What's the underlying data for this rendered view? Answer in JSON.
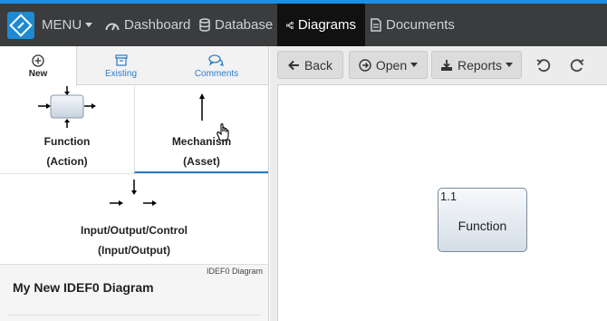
{
  "navbar": {
    "menu_label": "MENU",
    "items": [
      {
        "label": "Dashboard",
        "icon": "dashboard-icon"
      },
      {
        "label": "Database",
        "icon": "database-icon"
      },
      {
        "label": "Diagrams",
        "icon": "diagram-icon",
        "active": true
      },
      {
        "label": "Documents",
        "icon": "document-icon"
      }
    ]
  },
  "left_panel": {
    "tabs": [
      {
        "label": "New",
        "icon": "plus-circle-icon",
        "active": true
      },
      {
        "label": "Existing",
        "icon": "archive-icon"
      },
      {
        "label": "Comments",
        "icon": "comments-icon"
      }
    ],
    "tiles": {
      "function": {
        "line1": "Function",
        "line2": "(Action)"
      },
      "mechanism": {
        "line1": "Mechanism",
        "line2": "(Asset)"
      },
      "io": {
        "line1": "Input/Output/Control",
        "line2": "(Input/Output)"
      }
    },
    "diagram_info": {
      "type_label": "IDEF0 Diagram",
      "name": "My New IDEF0 Diagram"
    }
  },
  "toolbar": {
    "back_label": "Back",
    "open_label": "Open",
    "reports_label": "Reports",
    "undo_icon": "undo-icon",
    "redo_icon": "redo-icon"
  },
  "canvas": {
    "function_box": {
      "number": "1.1",
      "label": "Function"
    }
  },
  "colors": {
    "accent": "#1a8fe3",
    "navbar": "#3a3c3e",
    "active_nav": "#111111",
    "link_blue": "#2a7cc7"
  }
}
